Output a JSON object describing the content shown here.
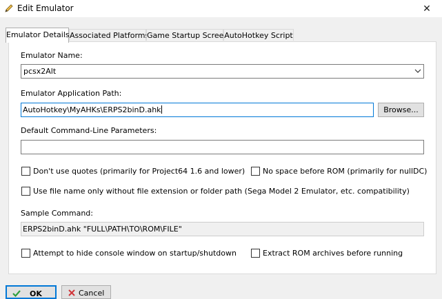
{
  "window": {
    "title": "Edit Emulator",
    "close_symbol": "✕"
  },
  "tabs": [
    {
      "label": "Emulator Details",
      "active": true
    },
    {
      "label": "Associated Platforms",
      "active": false
    },
    {
      "label": "Game Startup Screen",
      "active": false
    },
    {
      "label": "AutoHotkey Script",
      "active": false
    }
  ],
  "form": {
    "emulator_name_label": "Emulator Name:",
    "emulator_name_value": "pcsx2Alt",
    "app_path_label": "Emulator Application Path:",
    "app_path_value": "AutoHotkey\\MyAHKs\\ERPS2binD.ahk",
    "browse_label": "Browse...",
    "cmdline_label": "Default Command-Line Parameters:",
    "cmdline_value": "",
    "opt_no_quotes": "Don't use quotes (primarily for Project64 1.6 and lower)",
    "opt_no_space": "No space before ROM (primarily for nullDC)",
    "opt_filename_only": "Use file name only without file extension or folder path (Sega Model 2 Emulator, etc. compatibility)",
    "sample_label": "Sample Command:",
    "sample_value": "ERPS2binD.ahk \"FULL\\PATH\\TO\\ROM\\FILE\"",
    "opt_hide_console": "Attempt to hide console window on startup/shutdown",
    "opt_extract": "Extract ROM archives before running"
  },
  "footer": {
    "ok_label": "OK",
    "cancel_label": "Cancel"
  },
  "colors": {
    "accent": "#0078d7",
    "ok_check": "#2e9e3e",
    "cancel_x": "#d13438"
  }
}
